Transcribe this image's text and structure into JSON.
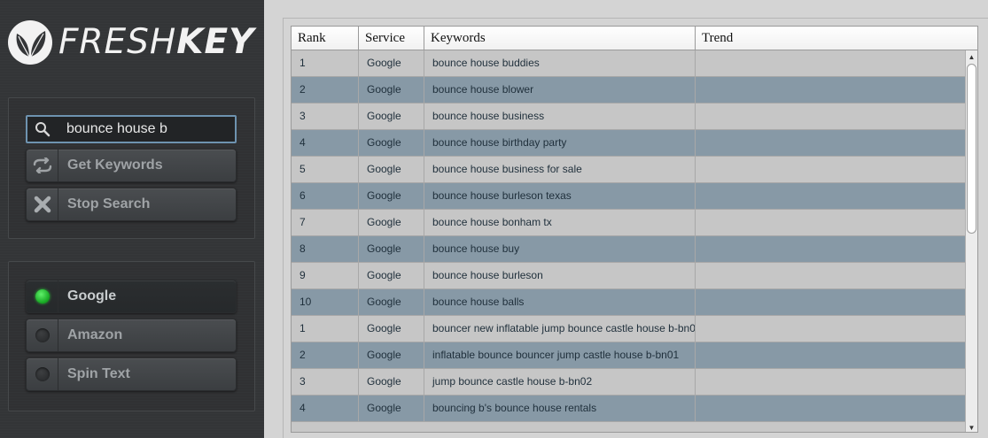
{
  "app": {
    "logo_light": "FRESH",
    "logo_bold": "KEY"
  },
  "search": {
    "value": "bounce house b",
    "icon": "search-icon"
  },
  "buttons": {
    "get_keywords": "Get Keywords",
    "stop_search": "Stop Search"
  },
  "services": [
    {
      "label": "Google",
      "status": "on"
    },
    {
      "label": "Amazon",
      "status": "off"
    },
    {
      "label": "Spin Text",
      "status": "off"
    }
  ],
  "table": {
    "headers": [
      "Rank",
      "Service",
      "Keywords",
      "Trend"
    ],
    "rows": [
      {
        "rank": "1",
        "service": "Google",
        "keyword": "bounce house buddies",
        "trend": ""
      },
      {
        "rank": "2",
        "service": "Google",
        "keyword": "bounce house blower",
        "trend": ""
      },
      {
        "rank": "3",
        "service": "Google",
        "keyword": "bounce house business",
        "trend": ""
      },
      {
        "rank": "4",
        "service": "Google",
        "keyword": "bounce house birthday party",
        "trend": ""
      },
      {
        "rank": "5",
        "service": "Google",
        "keyword": "bounce house business for sale",
        "trend": ""
      },
      {
        "rank": "6",
        "service": "Google",
        "keyword": "bounce house burleson texas",
        "trend": ""
      },
      {
        "rank": "7",
        "service": "Google",
        "keyword": "bounce house bonham tx",
        "trend": ""
      },
      {
        "rank": "8",
        "service": "Google",
        "keyword": "bounce house buy",
        "trend": ""
      },
      {
        "rank": "9",
        "service": "Google",
        "keyword": "bounce house burleson",
        "trend": ""
      },
      {
        "rank": "10",
        "service": "Google",
        "keyword": "bounce house balls",
        "trend": ""
      },
      {
        "rank": "1",
        "service": "Google",
        "keyword": "bouncer new inflatable jump bounce castle house b-bn0",
        "trend": ""
      },
      {
        "rank": "2",
        "service": "Google",
        "keyword": "inflatable bounce bouncer jump castle house b-bn01",
        "trend": ""
      },
      {
        "rank": "3",
        "service": "Google",
        "keyword": "jump bounce castle house b-bn02",
        "trend": ""
      },
      {
        "rank": "4",
        "service": "Google",
        "keyword": "bouncing b's bounce house rentals",
        "trend": ""
      }
    ]
  },
  "colors": {
    "sidebar_bg": "#333537",
    "row_odd": "#c6c6c6",
    "row_even": "#8799a6",
    "active_dot": "#1fb52b",
    "search_border": "#6e93b0"
  }
}
